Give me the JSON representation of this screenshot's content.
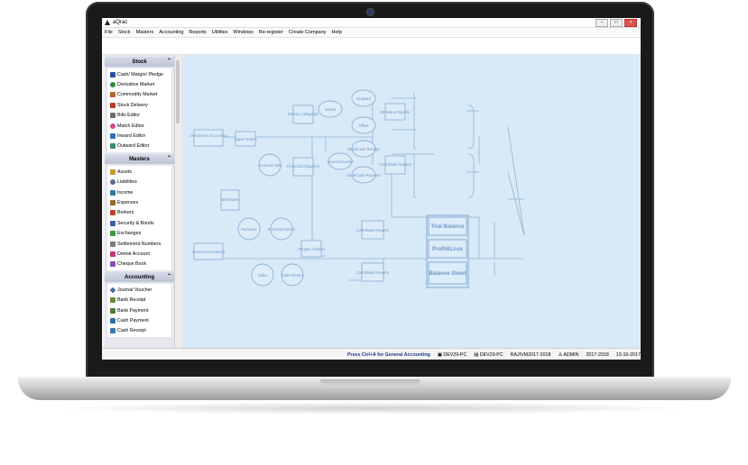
{
  "window": {
    "title": "aQrac"
  },
  "menu": [
    "File",
    "Stock",
    "Masters",
    "Accounting",
    "Reports",
    "Utilities",
    "Windows",
    "Re-register",
    "Create Company",
    "Help"
  ],
  "sidebar": {
    "sections": [
      {
        "title": "Stock",
        "items": [
          "Cash/ Margin/ Pledge",
          "Derivative Market",
          "Commodity Market",
          "Stock Delivery",
          "Bills Editor",
          "Match Editor",
          "Inward Editor",
          "Outward Editor"
        ]
      },
      {
        "title": "Masters",
        "items": [
          "Assets",
          "Liabilities",
          "Income",
          "Expenses",
          "Brokers",
          "Security & Bonds",
          "Exchanges",
          "Settlement Numbers",
          "Demat Account",
          "Cheque Book"
        ]
      },
      {
        "title": "Accounting",
        "items": [
          "Journal Voucher",
          "Bank Receipt",
          "Bank Payment",
          "Cash Payment",
          "Cash Receipt"
        ]
      }
    ]
  },
  "diagram": {
    "investment_accounting": "Investment Accounting",
    "import_trades": "Import Trades",
    "generate_bills": "Generate Bills",
    "bill_market": "Bill Market",
    "delivery_obligation": "Delivery Obligation",
    "inward": "Inward",
    "outward": "Outward",
    "offset": "Offset",
    "ms_value_reports": "MF/Value Reports",
    "financial_obligation": "Financial Obligation",
    "journal_voucher": "Journal Voucher",
    "bank_cash_receipt": "Bank/Cash Receipt",
    "bank_cash_payment": "Bank/Cash Payment",
    "cash_bank_reports_1": "Cash/Bank Reports",
    "cash_bank_reports_2": "Cash/Bank Reports",
    "cash_bank_reports_3": "Cash/Bank Reports",
    "purchase": "Purchase",
    "purchase_return": "Purchase Return",
    "prepare_challan": "Prepare Challan",
    "general_accounting": "General Accounting",
    "sales": "Sales",
    "sales_return": "Sales Return",
    "trial_balance": "Trial Balance",
    "profit_loss": "Profit&Loss",
    "balance_sheet": "Balance Sheet"
  },
  "status": {
    "hint": "Press Ctrl+A for General Accounting",
    "pc1": "DEV29-PC",
    "pc2": "DEV29-PC",
    "company": "RAJIVM2017-2018",
    "user": "ADMIN",
    "year": "2017-2018",
    "date": "13-10-2017"
  },
  "colors": {
    "diagram_bg": "#d8e9f7",
    "diagram_line": "#8fb3d6",
    "hint_text": "#1d3a8a"
  }
}
